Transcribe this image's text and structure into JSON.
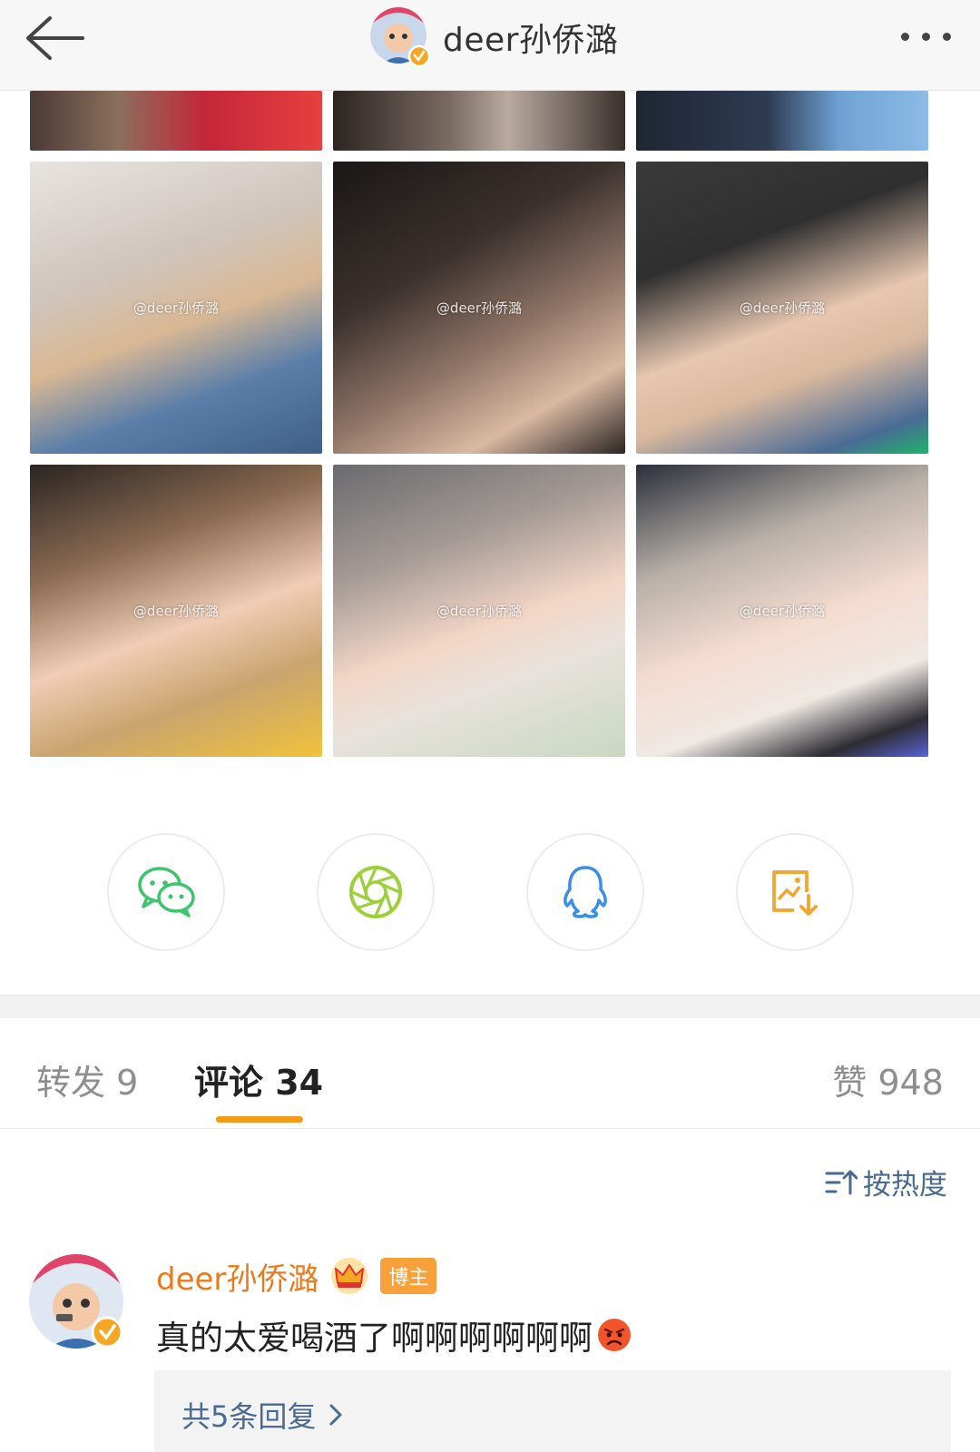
{
  "header": {
    "title": "deer孙侨潞",
    "back_icon": "back-arrow-icon",
    "more_icon": "more-dots-icon"
  },
  "photos": {
    "watermark": "@deer孙侨潞"
  },
  "share": {
    "items": [
      {
        "icon": "wechat-icon",
        "color": "#3ec46b"
      },
      {
        "icon": "moments-icon",
        "color": "#9ccf3a"
      },
      {
        "icon": "qq-icon",
        "color": "#3a8ee6"
      },
      {
        "icon": "save-image-icon",
        "color": "#f2a531"
      }
    ]
  },
  "tabs": {
    "repost": "转发 9",
    "comment": "评论 34",
    "like": "赞 948",
    "accent": "#f59a14"
  },
  "sort": {
    "label": "按热度"
  },
  "comment": {
    "author": "deer孙侨潞",
    "badge": "博主",
    "text": "真的太爱喝酒了啊啊啊啊啊啊",
    "emoji": "angry-face-emoji",
    "replies_label": "共5条回复"
  }
}
